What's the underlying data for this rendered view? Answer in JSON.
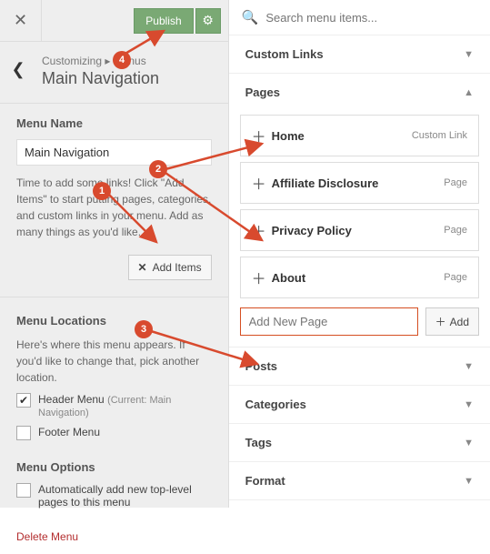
{
  "header": {
    "publish_label": "Publish"
  },
  "breadcrumb": {
    "path": "Customizing ▸ Menus",
    "title": "Main Navigation"
  },
  "menu_name": {
    "label": "Menu Name",
    "value": "Main Navigation",
    "help": "Time to add some links! Click \"Add Items\" to start putting pages, categories, and custom links in your menu. Add as many things as you'd like."
  },
  "add_items_label": "Add Items",
  "locations": {
    "title": "Menu Locations",
    "help": "Here's where this menu appears. If you'd like to change that, pick another location.",
    "items": [
      {
        "label": "Header Menu",
        "note": "(Current: Main Navigation)",
        "checked": true
      },
      {
        "label": "Footer Menu",
        "note": "",
        "checked": false
      }
    ]
  },
  "options": {
    "title": "Menu Options",
    "auto_add": "Automatically add new top-level pages to this menu"
  },
  "delete_label": "Delete Menu",
  "search": {
    "placeholder": "Search menu items..."
  },
  "accordions": {
    "custom_links": "Custom Links",
    "pages": "Pages",
    "posts": "Posts",
    "categories": "Categories",
    "tags": "Tags",
    "format": "Format"
  },
  "pages": [
    {
      "label": "Home",
      "type": "Custom Link"
    },
    {
      "label": "Affiliate Disclosure",
      "type": "Page"
    },
    {
      "label": "Privacy Policy",
      "type": "Page"
    },
    {
      "label": "About",
      "type": "Page"
    }
  ],
  "add_page": {
    "placeholder": "Add New Page",
    "button": "Add"
  },
  "annotations": {
    "b1": "1",
    "b2": "2",
    "b3": "3",
    "b4": "4"
  }
}
